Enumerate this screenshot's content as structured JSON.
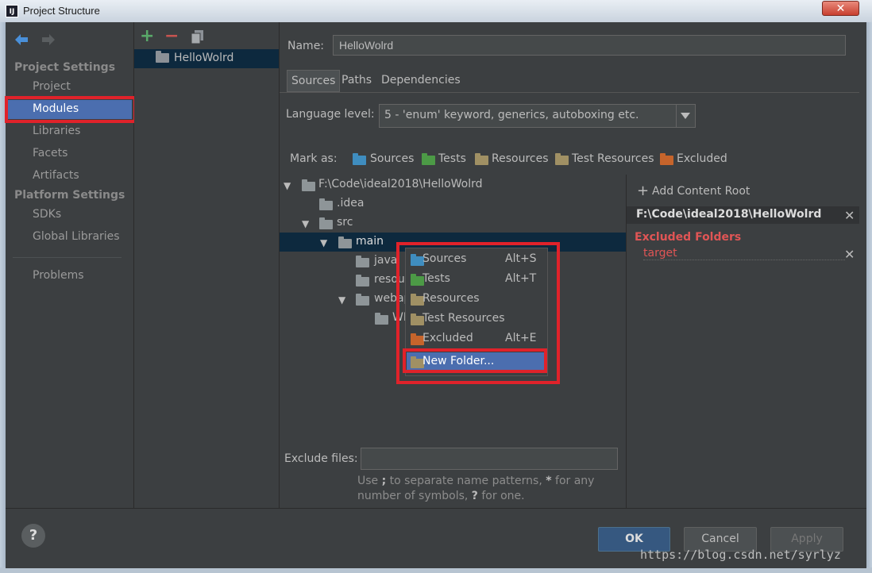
{
  "window": {
    "title": "Project Structure",
    "app_icon_label": "IJ",
    "close_glyph": "✕"
  },
  "nav": {
    "back_icon": "arrow-left-icon",
    "forward_icon": "arrow-right-icon",
    "project_settings_header": "Project Settings",
    "project_settings_items": [
      "Project",
      "Modules",
      "Libraries",
      "Facets",
      "Artifacts"
    ],
    "platform_settings_header": "Platform Settings",
    "platform_settings_items": [
      "SDKs",
      "Global Libraries"
    ],
    "problems": "Problems",
    "selected": "Modules"
  },
  "modules": {
    "toolbar": {
      "add": "+",
      "remove": "−",
      "copy": "copy-icon"
    },
    "items": [
      "HelloWolrd"
    ]
  },
  "main": {
    "name_label": "Name:",
    "name_value": "HelloWolrd",
    "tabs": [
      "Sources",
      "Paths",
      "Dependencies"
    ],
    "active_tab": "Sources",
    "language_label": "Language level:",
    "language_value": "5 - 'enum' keyword, generics, autoboxing etc.",
    "mark_as_label": "Mark as:",
    "mark_as": [
      "Sources",
      "Tests",
      "Resources",
      "Test Resources",
      "Excluded"
    ],
    "tree": {
      "root": "F:\\Code\\ideal2018\\HelloWolrd",
      "idea": ".idea",
      "src": "src",
      "main": "main",
      "java": "java",
      "resources": "resou",
      "webapp": "webap",
      "web_inf": "WI"
    },
    "exclude_label": "Exclude files:",
    "exclude_value": "",
    "hint_prefix": "Use ",
    "hint_sep": ";",
    "hint_mid": " to separate name patterns, ",
    "hint_star": "*",
    "hint_mid2": " for any",
    "hint_line2_a": "number of symbols, ",
    "hint_q": "?",
    "hint_line2_b": " for one."
  },
  "context_menu": {
    "items": [
      {
        "label": "Sources",
        "shortcut": "Alt+S"
      },
      {
        "label": "Tests",
        "shortcut": "Alt+T"
      },
      {
        "label": "Resources",
        "shortcut": ""
      },
      {
        "label": "Test Resources",
        "shortcut": ""
      },
      {
        "label": "Excluded",
        "shortcut": "Alt+E"
      },
      {
        "label": "New Folder...",
        "shortcut": ""
      }
    ],
    "selected": "New Folder..."
  },
  "content_root": {
    "add_label": "Add Content Root",
    "add_glyph": "+",
    "path": "F:\\Code\\ideal2018\\HelloWolrd",
    "excluded_header": "Excluded Folders",
    "excluded_items": [
      "target"
    ],
    "remove_glyph": "✕"
  },
  "buttons": {
    "ok": "OK",
    "cancel": "Cancel",
    "apply": "Apply",
    "help": "?"
  },
  "watermark": "https://blog.csdn.net/syrlyz",
  "colors": {
    "background": "#3c3f41",
    "selection": "#4b6eaf",
    "tree_selection": "#0d293e",
    "highlight_box": "#e0222a",
    "excluded_header": "#e05555"
  }
}
